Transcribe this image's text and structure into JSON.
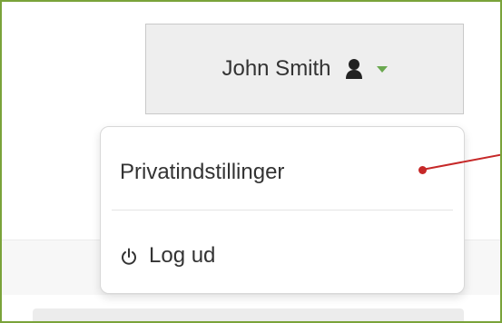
{
  "user_menu": {
    "name": "John Smith",
    "icon": "user-icon",
    "caret_color": "#6aa84f"
  },
  "dropdown": {
    "items": [
      {
        "label": "Privatindstillinger"
      },
      {
        "label": "Log ud",
        "icon": "power-icon"
      }
    ]
  },
  "annotation": {
    "color": "#c62828"
  },
  "frame": {
    "border_color": "#7aa33a"
  }
}
